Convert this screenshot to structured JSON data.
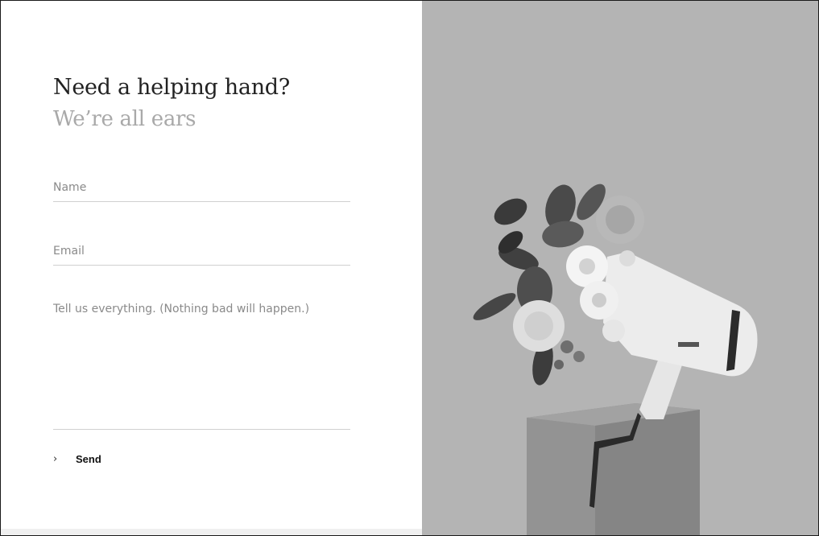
{
  "heading": "Need a helping hand?",
  "subheading": "We’re all ears",
  "form": {
    "name_placeholder": "Name",
    "name_value": "",
    "email_placeholder": "Email",
    "email_value": "",
    "message_placeholder": "Tell us everything. (Nothing bad will happen.)",
    "message_value": "",
    "send_label": "Send",
    "send_icon": "chevron-right-icon"
  },
  "image": {
    "subject": "megaphone-with-flowers",
    "background_color": "#b4b4b4"
  }
}
